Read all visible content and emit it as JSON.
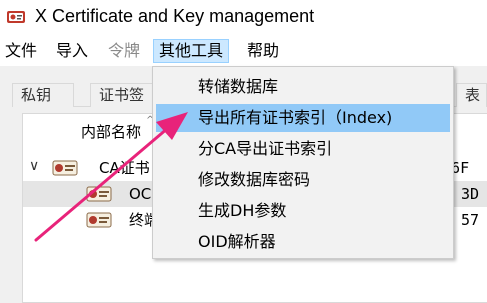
{
  "window": {
    "title": "X Certificate and Key management"
  },
  "menubar": {
    "items": [
      {
        "label": "文件"
      },
      {
        "label": "导入"
      },
      {
        "label": "令牌"
      },
      {
        "label": "其他工具"
      },
      {
        "label": "帮助"
      }
    ]
  },
  "tabs": [
    {
      "label": "私钥"
    },
    {
      "label": "证书签"
    },
    {
      "label": "表"
    }
  ],
  "tree": {
    "column_header": "内部名称",
    "rows": [
      {
        "label": "CA证书",
        "extra": "e 6F"
      },
      {
        "label": "OC",
        "extra": "3D"
      },
      {
        "label": "终端",
        "extra": "57"
      }
    ]
  },
  "dropdown": {
    "items": [
      {
        "label": "转储数据库"
      },
      {
        "label": "导出所有证书索引（Index)"
      },
      {
        "label": "分CA导出证书索引"
      },
      {
        "label": "修改数据库密码"
      },
      {
        "label": "生成DH参数"
      },
      {
        "label": "OID解析器"
      }
    ]
  },
  "colors": {
    "menu_active_bg": "#cce8ff",
    "dropdown_highlight": "#91c9f7",
    "annotation_arrow": "#e8237a"
  }
}
